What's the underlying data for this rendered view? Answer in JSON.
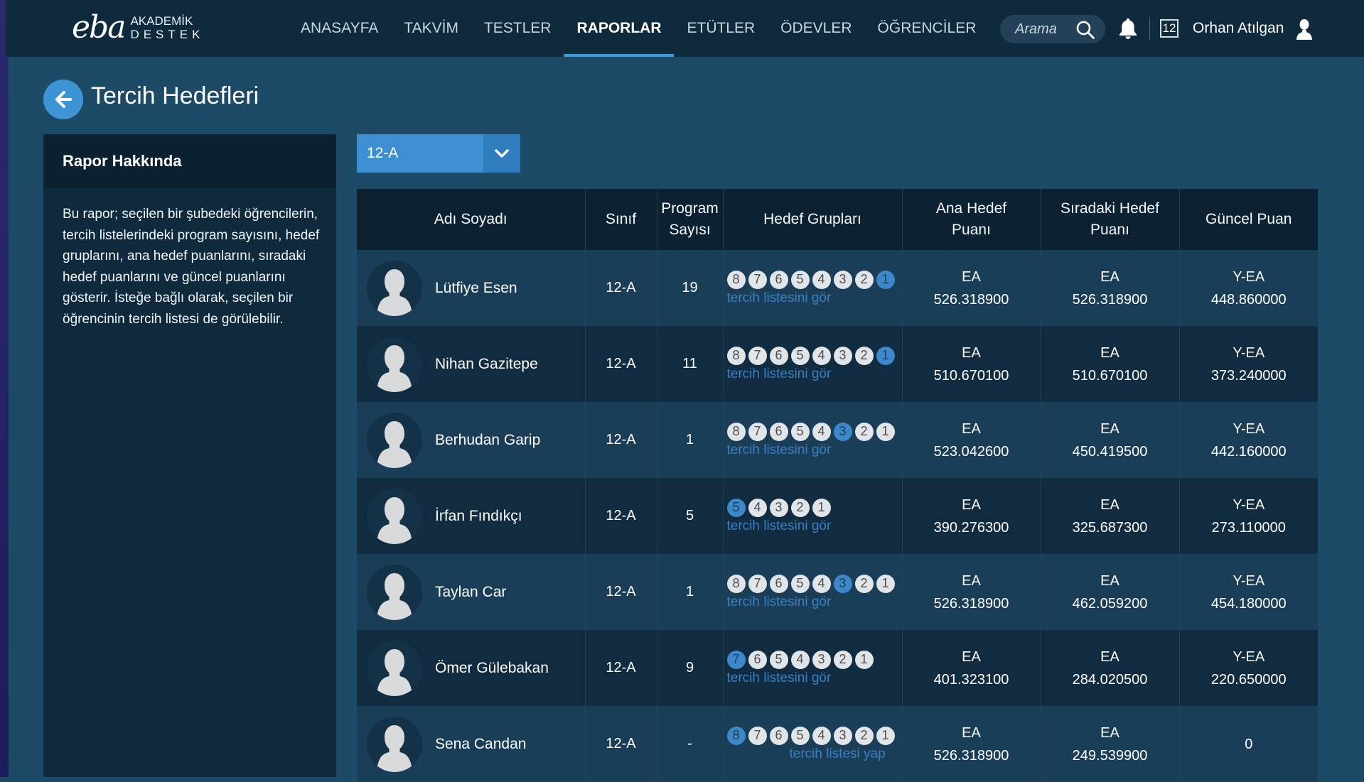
{
  "brand": {
    "logo_mark": "eba",
    "line1": "AKADEMİK",
    "line2": "DESTEK"
  },
  "nav": [
    {
      "label": "ANASAYFA",
      "active": false
    },
    {
      "label": "TAKVİM",
      "active": false
    },
    {
      "label": "TESTLER",
      "active": false
    },
    {
      "label": "RAPORLAR",
      "active": true
    },
    {
      "label": "ETÜTLER",
      "active": false
    },
    {
      "label": "ÖDEVLER",
      "active": false
    },
    {
      "label": "ÖĞRENCİLER",
      "active": false
    }
  ],
  "header": {
    "search_placeholder": "Arama",
    "grade": "12",
    "user_name": "Orhan Atılgan"
  },
  "page": {
    "title": "Tercih Hedefleri"
  },
  "sidebar": {
    "title": "Rapor Hakkında",
    "text": "Bu rapor; seçilen bir şubedeki öğrencilerin, tercih listelerindeki program sayısını, hedef gruplarını, ana hedef puanlarını, sıradaki hedef puanlarını ve güncel puanlarını gösterir. İsteğe bağlı olarak, seçilen bir öğrencinin tercih listesi de görülebilir."
  },
  "class_select": {
    "value": "12-A"
  },
  "table": {
    "headers": {
      "name": "Adı Soyadı",
      "class": "Sınıf",
      "program_l1": "Program",
      "program_l2": "Sayısı",
      "groups": "Hedef Grupları",
      "main_l1": "Ana Hedef",
      "main_l2": "Puanı",
      "next_l1": "Sıradaki Hedef",
      "next_l2": "Puanı",
      "current": "Güncel Puan"
    },
    "rows": [
      {
        "name": "Lütfiye Esen",
        "class": "12-A",
        "program_count": "19",
        "groups": [
          "8",
          "7",
          "6",
          "5",
          "4",
          "3",
          "2",
          "1"
        ],
        "highlight": "1",
        "link": "tercih listesini gör",
        "main_type": "EA",
        "main_score": "526.318900",
        "next_type": "EA",
        "next_score": "526.318900",
        "current_type": "Y-EA",
        "current_score": "448.860000"
      },
      {
        "name": "Nihan Gazitepe",
        "class": "12-A",
        "program_count": "11",
        "groups": [
          "8",
          "7",
          "6",
          "5",
          "4",
          "3",
          "2",
          "1"
        ],
        "highlight": "1",
        "link": "tercih listesini gör",
        "main_type": "EA",
        "main_score": "510.670100",
        "next_type": "EA",
        "next_score": "510.670100",
        "current_type": "Y-EA",
        "current_score": "373.240000"
      },
      {
        "name": "Berhudan Garip",
        "class": "12-A",
        "program_count": "1",
        "groups": [
          "8",
          "7",
          "6",
          "5",
          "4",
          "3",
          "2",
          "1"
        ],
        "highlight": "3",
        "link": "tercih listesini gör",
        "main_type": "EA",
        "main_score": "523.042600",
        "next_type": "EA",
        "next_score": "450.419500",
        "current_type": "Y-EA",
        "current_score": "442.160000"
      },
      {
        "name": "İrfan Fındıkçı",
        "class": "12-A",
        "program_count": "5",
        "groups": [
          "5",
          "4",
          "3",
          "2",
          "1"
        ],
        "highlight": "5",
        "link": "tercih listesini gör",
        "main_type": "EA",
        "main_score": "390.276300",
        "next_type": "EA",
        "next_score": "325.687300",
        "current_type": "Y-EA",
        "current_score": "273.110000"
      },
      {
        "name": "Taylan Car",
        "class": "12-A",
        "program_count": "1",
        "groups": [
          "8",
          "7",
          "6",
          "5",
          "4",
          "3",
          "2",
          "1"
        ],
        "highlight": "3",
        "link": "tercih listesini gör",
        "main_type": "EA",
        "main_score": "526.318900",
        "next_type": "EA",
        "next_score": "462.059200",
        "current_type": "Y-EA",
        "current_score": "454.180000"
      },
      {
        "name": "Ömer Gülebakan",
        "class": "12-A",
        "program_count": "9",
        "groups": [
          "7",
          "6",
          "5",
          "4",
          "3",
          "2",
          "1"
        ],
        "highlight": "7",
        "link": "tercih listesini gör",
        "main_type": "EA",
        "main_score": "401.323100",
        "next_type": "EA",
        "next_score": "284.020500",
        "current_type": "Y-EA",
        "current_score": "220.650000"
      },
      {
        "name": "Sena Candan",
        "class": "12-A",
        "program_count": "-",
        "groups": [
          "8",
          "7",
          "6",
          "5",
          "4",
          "3",
          "2",
          "1"
        ],
        "highlight": "8",
        "link": "tercih listesi yap",
        "main_type": "EA",
        "main_score": "526.318900",
        "next_type": "EA",
        "next_score": "249.539900",
        "current_type": "",
        "current_score": "0"
      }
    ]
  },
  "colors": {
    "nav_bg": "#0f2a3d",
    "page_bg": "#1d4a67",
    "accent": "#3d95d6",
    "row_odd": "#1a3e57",
    "row_even": "#112c40"
  }
}
